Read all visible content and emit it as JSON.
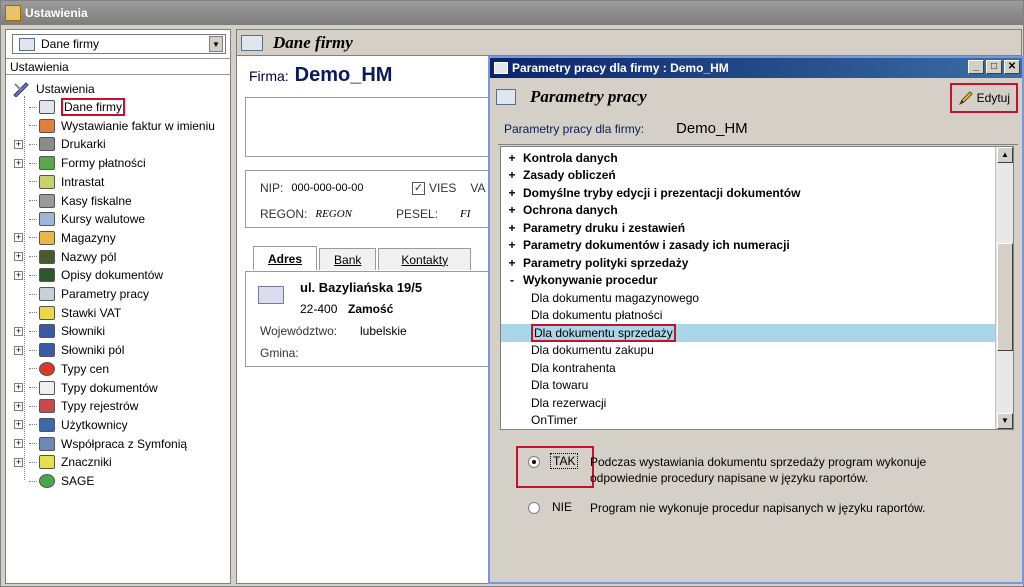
{
  "window": {
    "title": "Ustawienia"
  },
  "left": {
    "select_value": "Dane firmy",
    "header": "Ustawienia",
    "root": "Ustawienia",
    "items": [
      {
        "label": "Dane firmy",
        "expandable": false,
        "icon": "company-icon",
        "highlighted": true
      },
      {
        "label": "Wystawianie faktur w imieniu",
        "expandable": false,
        "icon": "person-icon"
      },
      {
        "label": "Drukarki",
        "expandable": true,
        "icon": "printer-icon"
      },
      {
        "label": "Formy płatności",
        "expandable": true,
        "icon": "payment-icon"
      },
      {
        "label": "Intrastat",
        "expandable": false,
        "icon": "document-icon"
      },
      {
        "label": "Kasy fiskalne",
        "expandable": false,
        "icon": "cash-register-icon"
      },
      {
        "label": "Kursy walutowe",
        "expandable": false,
        "icon": "chart-icon"
      },
      {
        "label": "Magazyny",
        "expandable": true,
        "icon": "warehouse-icon"
      },
      {
        "label": "Nazwy pól",
        "expandable": true,
        "icon": "field-names-icon"
      },
      {
        "label": "Opisy dokumentów",
        "expandable": true,
        "icon": "document-desc-icon"
      },
      {
        "label": "Parametry pracy",
        "expandable": false,
        "icon": "parameters-icon"
      },
      {
        "label": "Stawki VAT",
        "expandable": false,
        "icon": "vat-icon"
      },
      {
        "label": "Słowniki",
        "expandable": true,
        "icon": "dictionary-icon"
      },
      {
        "label": "Słowniki pól",
        "expandable": true,
        "icon": "field-dictionary-icon"
      },
      {
        "label": "Typy cen",
        "expandable": false,
        "icon": "price-type-icon"
      },
      {
        "label": "Typy dokumentów",
        "expandable": true,
        "icon": "document-types-icon"
      },
      {
        "label": "Typy rejestrów",
        "expandable": true,
        "icon": "registers-icon"
      },
      {
        "label": "Użytkownicy",
        "expandable": true,
        "icon": "users-icon"
      },
      {
        "label": "Współpraca z Symfonią",
        "expandable": true,
        "icon": "sync-icon"
      },
      {
        "label": "Znaczniki",
        "expandable": true,
        "icon": "tags-icon"
      },
      {
        "label": "SAGE",
        "expandable": false,
        "icon": "sage-icon"
      }
    ]
  },
  "center": {
    "title": "Dane firmy",
    "firma_label": "Firma:",
    "firma_value": "Demo_HM",
    "nip_label": "NIP:",
    "nip_value": "000-000-00-00",
    "vies_label": "VIES",
    "vies_checked": true,
    "va_cut": "VA",
    "regon_label": "REGON:",
    "regon_value": "REGON",
    "pesel_label": "PESEL:",
    "pesel_cut": "FI",
    "tabs": [
      "Adres",
      "Bank",
      "Kontakty"
    ],
    "street": "ul. Bazyliańska 19/5",
    "zip": "22-400",
    "city": "Zamość",
    "wojewodztwo_label": "Województwo:",
    "wojewodztwo_value": "lubelskie",
    "gmina_label": "Gmina:"
  },
  "dialog": {
    "title": "Parametry pracy dla firmy : Demo_HM",
    "header": "Parametry pracy",
    "edit_label": "Edytuj",
    "params_label": "Parametry pracy dla firmy:",
    "params_value": "Demo_HM",
    "list": [
      {
        "prefix": "+",
        "label": "Kontrola danych",
        "bold": true
      },
      {
        "prefix": "+",
        "label": "Zasady obliczeń",
        "bold": true
      },
      {
        "prefix": "+",
        "label": "Domyślne tryby edycji i prezentacji dokumentów",
        "bold": true
      },
      {
        "prefix": "+",
        "label": "Ochrona danych",
        "bold": true
      },
      {
        "prefix": "+",
        "label": "Parametry druku i zestawień",
        "bold": true
      },
      {
        "prefix": "+",
        "label": "Parametry dokumentów i zasady ich numeracji",
        "bold": true
      },
      {
        "prefix": "+",
        "label": "Parametry polityki sprzedaży",
        "bold": true
      },
      {
        "prefix": "-",
        "label": "Wykonywanie procedur",
        "bold": true
      },
      {
        "prefix": "",
        "label": "Dla dokumentu magazynowego",
        "bold": false
      },
      {
        "prefix": "",
        "label": "Dla dokumentu płatności",
        "bold": false
      },
      {
        "prefix": "",
        "label": "Dla dokumentu sprzedaży",
        "bold": false,
        "selected": true
      },
      {
        "prefix": "",
        "label": "Dla dokumentu zakupu",
        "bold": false
      },
      {
        "prefix": "",
        "label": "Dla kontrahenta",
        "bold": false
      },
      {
        "prefix": "",
        "label": "Dla towaru",
        "bold": false
      },
      {
        "prefix": "",
        "label": "Dla rezerwacji",
        "bold": false
      },
      {
        "prefix": "",
        "label": "OnTimer",
        "bold": false
      }
    ],
    "option_tak": "TAK",
    "option_tak_desc": "Podczas wystawiania dokumentu sprzedaży program wykonuje odpowiednie procedury napisane w języku raportów.",
    "option_nie": "NIE",
    "option_nie_desc": "Program nie wykonuje procedur napisanych w języku raportów.",
    "selected_option": "TAK"
  },
  "colors": {
    "highlight": "#c8102e",
    "selection": "#a9d6e8",
    "dialog_title": "#0a246a"
  }
}
